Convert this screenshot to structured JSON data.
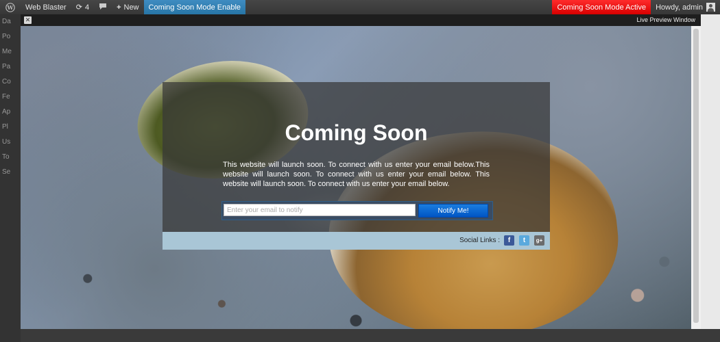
{
  "admin_bar": {
    "site_name": "Web Blaster",
    "updates_count": "4",
    "new_label": "New",
    "coming_soon_enable": "Coming Soon Mode Enable",
    "coming_soon_active": "Coming Soon Mode Active",
    "howdy": "Howdy, admin"
  },
  "preview": {
    "title": "Live Preview Window",
    "close": "✕"
  },
  "page": {
    "heading": "Coming Soon",
    "description": "This website will launch soon. To connect with us enter your email below.This website will launch soon. To connect with us enter your email below. This website will launch soon. To connect with us enter your email below.",
    "email_placeholder": "Enter your email to notify",
    "notify_button": "Notify Me!",
    "social_label": "Social Links :",
    "social": [
      "f",
      "t",
      "g+"
    ]
  },
  "colors": {
    "admin_active": "#2b7fb4",
    "admin_red": "#e11111",
    "button_blue": "#0055c4",
    "social_bar": "#a9c6d6"
  }
}
